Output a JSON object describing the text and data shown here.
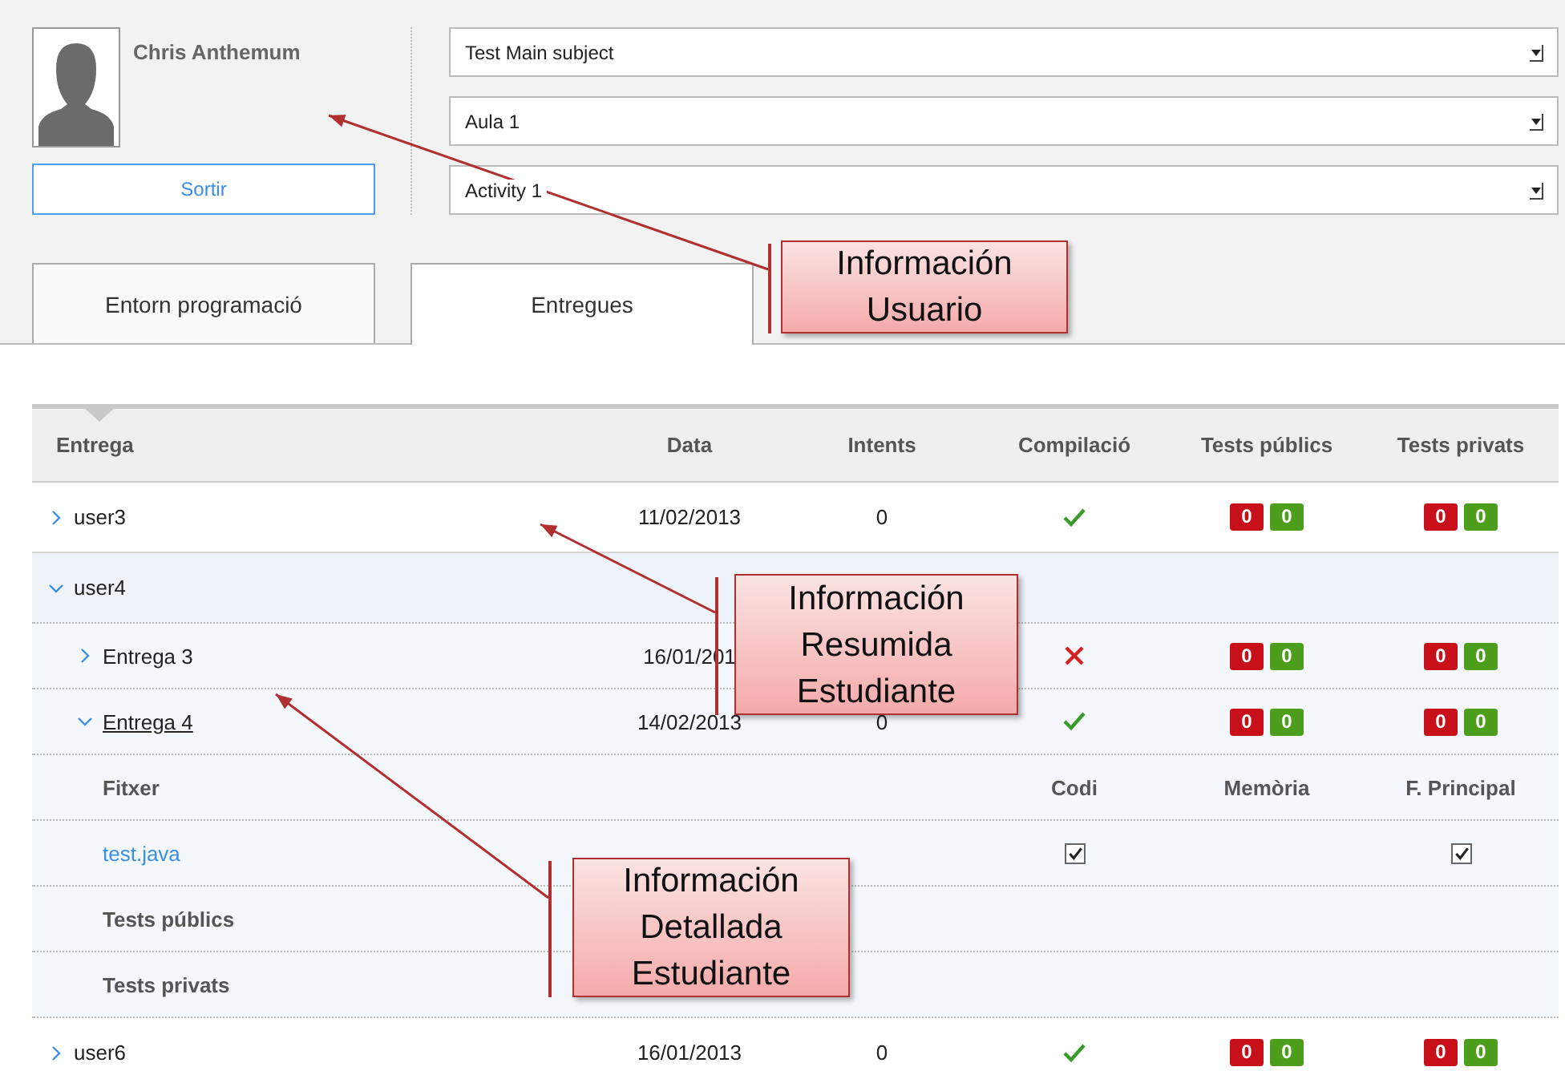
{
  "user": {
    "name": "Chris Anthemum",
    "logout_button": "Sortir"
  },
  "selects": [
    {
      "value": "Test Main subject"
    },
    {
      "value": "Aula 1"
    },
    {
      "value": "Activity 1"
    }
  ],
  "tabs": [
    {
      "label": "Entorn programació",
      "selected": false
    },
    {
      "label": "Entregues",
      "selected": true
    }
  ],
  "table": {
    "columns": [
      "Entrega",
      "Data",
      "Intents",
      "Compilació",
      "Tests públics",
      "Tests privats"
    ],
    "rows": [
      {
        "name": "user3",
        "expanded": false,
        "date": "11/02/2013",
        "attempts": "0",
        "compiled": true,
        "public": {
          "failed": "0",
          "passed": "0"
        },
        "private": {
          "failed": "0",
          "passed": "0"
        }
      },
      {
        "name": "user4",
        "expanded": true,
        "children": [
          {
            "name": "Entrega 3",
            "expanded": false,
            "date": "16/01/201",
            "compiled": false,
            "public": {
              "failed": "0",
              "passed": "0"
            },
            "private": {
              "failed": "0",
              "passed": "0"
            }
          },
          {
            "name": "Entrega 4",
            "expanded": true,
            "date": "14/02/2013",
            "attempts": "0",
            "compiled": true,
            "public": {
              "failed": "0",
              "passed": "0"
            },
            "private": {
              "failed": "0",
              "passed": "0"
            },
            "detail": {
              "file_columns": [
                "Fitxer",
                "Codi",
                "Memòria",
                "F. Principal"
              ],
              "files": [
                {
                  "name": "test.java",
                  "code": true,
                  "main": true
                }
              ],
              "sections": [
                "Tests públics",
                "Tests privats"
              ]
            }
          }
        ]
      },
      {
        "name": "user6",
        "expanded": false,
        "date": "16/01/2013",
        "attempts": "0",
        "compiled": true,
        "public": {
          "failed": "0",
          "passed": "0"
        },
        "private": {
          "failed": "0",
          "passed": "0"
        }
      }
    ]
  },
  "callouts": [
    {
      "lines": [
        "Información",
        "Usuario"
      ]
    },
    {
      "lines": [
        "Información",
        "Resumida",
        "Estudiante"
      ]
    },
    {
      "lines": [
        "Información",
        "Detallada",
        "Estudiante"
      ]
    }
  ]
}
